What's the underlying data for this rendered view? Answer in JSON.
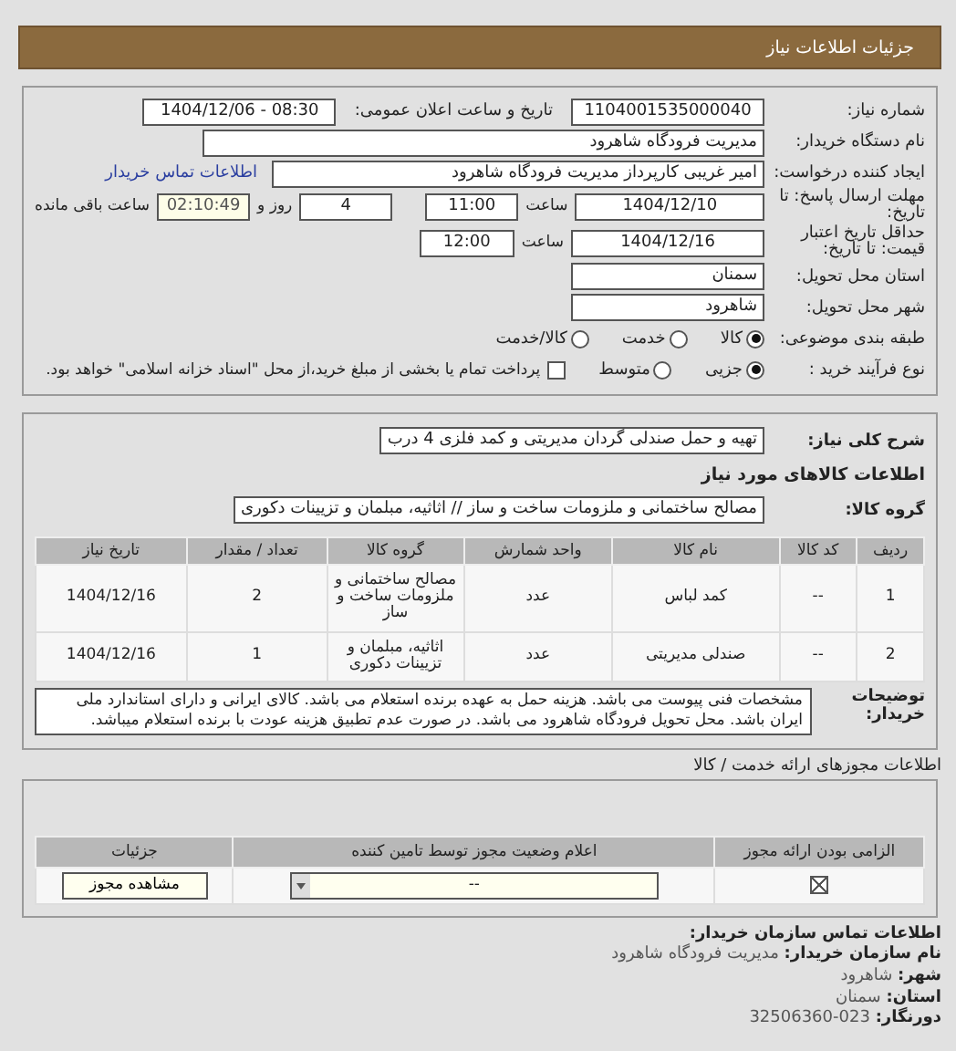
{
  "header": {
    "title": "جزئیات اطلاعات نیاز"
  },
  "need": {
    "number_label": "شماره نیاز:",
    "number": "1104001535000040",
    "announce_label": "تاریخ و ساعت اعلان عمومی:",
    "announce": "1404/12/06 - 08:30",
    "buyer_label": "نام دستگاه خریدار:",
    "buyer": "مدیریت فرودگاه شاهرود",
    "creator_label": "ایجاد کننده درخواست:",
    "creator": "امیر غریبی کارپرداز مدیریت فرودگاه شاهرود",
    "contact_link": "اطلاعات تماس خریدار",
    "deadline_label": "مهلت ارسال پاسخ: تا تاریخ:",
    "deadline_date": "1404/12/10",
    "time_label": "ساعت",
    "deadline_time": "11:00",
    "days": "4",
    "days_label": "روز و",
    "remaining": "02:10:49",
    "remaining_label": "ساعت باقی مانده",
    "validity_label": "حداقل تاریخ اعتبار قیمت: تا تاریخ:",
    "validity_date": "1404/12/16",
    "validity_time_label": "ساعت",
    "validity_time": "12:00",
    "province_label": "استان محل تحویل:",
    "province": "سمنان",
    "city_label": "شهر محل تحویل:",
    "city": "شاهرود",
    "category_label": "طبقه بندی موضوعی:",
    "categories": [
      {
        "label": "کالا",
        "selected": true
      },
      {
        "label": "خدمت",
        "selected": false
      },
      {
        "label": "کالا/خدمت",
        "selected": false
      }
    ],
    "process_label": "نوع فرآیند خرید :",
    "processes": [
      {
        "label": "جزیی",
        "selected": true
      },
      {
        "label": "متوسط",
        "selected": false
      }
    ],
    "treasury": {
      "label": "پرداخت تمام یا بخشی از مبلغ خرید،از محل \"اسناد خزانه اسلامی\" خواهد بود.",
      "checked": false
    }
  },
  "goods": {
    "summary_label": "شرح کلی نیاز:",
    "summary": "تهیه و حمل صندلی گردان مدیریتی و کمد فلزی 4 درب",
    "section_title": "اطلاعات کالاهای مورد نیاز",
    "group_label": "گروه کالا:",
    "group": "مصالح ساختمانی و ملزومات ساخت و ساز // اثاثیه، مبلمان و تزیینات دکوری",
    "columns": [
      "ردیف",
      "کد کالا",
      "نام کالا",
      "واحد شمارش",
      "گروه کالا",
      "تعداد / مقدار",
      "تاریخ نیاز"
    ],
    "rows": [
      [
        "1",
        "--",
        "کمد لباس",
        "عدد",
        "مصالح ساختمانی و ملزومات ساخت و ساز",
        "2",
        "1404/12/16"
      ],
      [
        "2",
        "--",
        "صندلی مدیریتی",
        "عدد",
        "اثاثیه، مبلمان و تزیینات دکوری",
        "1",
        "1404/12/16"
      ]
    ],
    "notes_label": "توضیحات خریدار:",
    "notes": "مشخصات فنی پیوست می باشد. هزینه حمل به عهده برنده استعلام می باشد. کالای ایرانی و دارای استاندارد ملی ایران باشد. محل تحویل فرودگاه شاهرود می باشد. در صورت عدم تطبیق هزینه عودت با برنده استعلام میباشد."
  },
  "licenses": {
    "title": "اطلاعات مجوزهای ارائه خدمت / کالا",
    "columns": [
      "الزامی بودن ارائه مجوز",
      "اعلام وضعیت مجوز توسط تامین کننده",
      "جزئیات"
    ],
    "rows": [
      {
        "required": true,
        "status": "--",
        "button": "مشاهده مجوز"
      }
    ]
  },
  "contact": {
    "title": "اطلاعات تماس سازمان خریدار:",
    "lines": [
      {
        "label": "نام سازمان خریدار:",
        "value": "مدیریت فرودگاه شاهرود"
      },
      {
        "label": "شهر:",
        "value": "شاهرود"
      },
      {
        "label": "استان:",
        "value": "سمنان"
      },
      {
        "label": "دورنگار:",
        "value": "023-32506360"
      }
    ]
  }
}
